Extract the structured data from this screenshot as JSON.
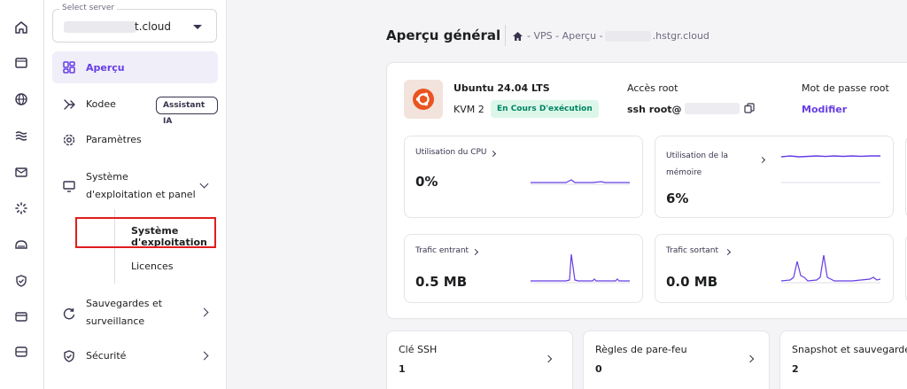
{
  "server_select": {
    "label": "Select server",
    "value": "t.cloud"
  },
  "rail": {
    "icons": [
      "home-icon",
      "window-icon",
      "globe-icon",
      "layers-icon",
      "mail-icon",
      "loader-icon",
      "disk-icon",
      "shield-icon",
      "card-icon",
      "server-icon"
    ]
  },
  "nav": {
    "apercu": "Aperçu",
    "kodee": "Kodee",
    "kodee_badge": "Assistant IA",
    "parametres": "Paramètres",
    "os_panel_line1": "Système",
    "os_panel_line2": "d'exploitation et panel",
    "sub_os": "Système d'exploitation",
    "sub_licences": "Licences",
    "backups_line1": "Sauvegardes et",
    "backups_line2": "surveillance",
    "securite": "Sécurité"
  },
  "page": {
    "title": "Aperçu général",
    "breadcrumb_prefix": "- VPS - Aperçu -",
    "breadcrumb_suffix": ".hstgr.cloud"
  },
  "overview": {
    "os_name": "Ubuntu 24.04 LTS",
    "plan": "KVM 2",
    "status": "En Cours D'exécution",
    "root_label": "Accès root",
    "root_value": "ssh root@",
    "password_label": "Mot de passe root",
    "password_action": "Modifier"
  },
  "metrics": {
    "cpu_label": "Utilisation du CPU",
    "cpu_value": "0%",
    "memory_label": "Utilisation de la mémoire",
    "memory_value": "6%",
    "in_label": "Trafic entrant",
    "in_value": "0.5 MB",
    "out_label": "Trafic sortant",
    "out_value": "0.0 MB"
  },
  "bottom_cards": {
    "ssh_label": "Clé SSH",
    "ssh_value": "1",
    "firewall_label": "Règles de pare-feu",
    "firewall_value": "0",
    "snapshot_label": "Snapshot et sauvegardes",
    "snapshot_value": "2"
  },
  "colors": {
    "accent": "#673de6",
    "status_bg": "#dcf7ea",
    "status_text": "#008361",
    "highlight_border": "#e11d1d"
  }
}
